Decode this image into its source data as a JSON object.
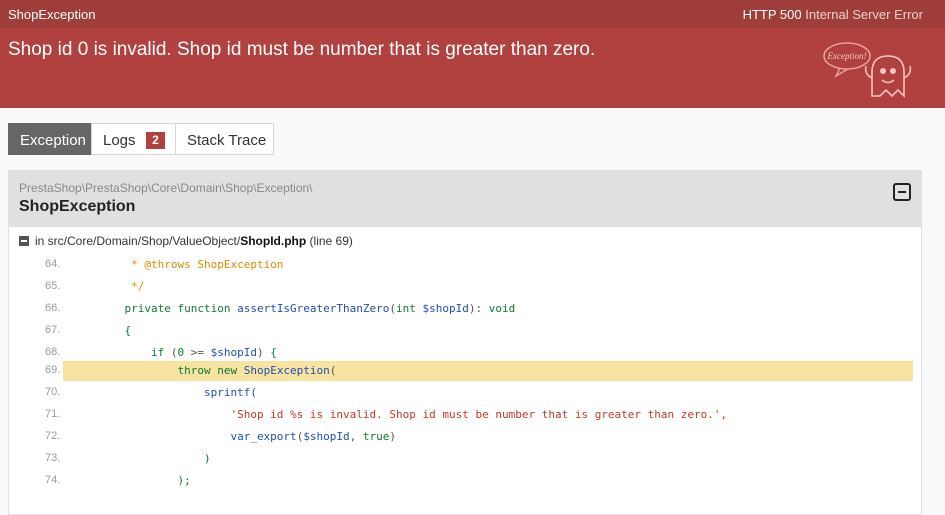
{
  "topbar": {
    "title": "ShopException",
    "status_code": "HTTP 500",
    "status_text": "Internal Server Error"
  },
  "header": {
    "message": "Shop id 0 is invalid. Shop id must be number that is greater than zero.",
    "mascot_text": "Exception!"
  },
  "tabs": [
    {
      "label": "Exception",
      "active": true
    },
    {
      "label": "Logs",
      "badge": "2"
    },
    {
      "label": "Stack Trace"
    }
  ],
  "exception": {
    "namespace": "PrestaShop\\PrestaShop\\Core\\Domain\\Shop\\Exception\\",
    "class_name": "ShopException",
    "location_prefix": "in src/Core/Domain/Shop/ValueObject/",
    "file_name": "ShopId.php",
    "line_info": "(line 69)"
  },
  "code": {
    "highlighted_line": "69.",
    "lines": [
      {
        "num": "64.",
        "text": "     * @throws ShopException"
      },
      {
        "num": "65.",
        "text": "     */"
      },
      {
        "num": "66.",
        "text": "    private function assertIsGreaterThanZero(int $shopId): void"
      },
      {
        "num": "67.",
        "text": "    {"
      },
      {
        "num": "68.",
        "text": "        if (0 >= $shopId) {"
      },
      {
        "num": "69.",
        "text": "            throw new ShopException("
      },
      {
        "num": "70.",
        "text": "                sprintf("
      },
      {
        "num": "71.",
        "text": "                    'Shop id %s is invalid. Shop id must be number that is greater than zero.',"
      },
      {
        "num": "72.",
        "text": "                    var_export($shopId, true)"
      },
      {
        "num": "73.",
        "text": "                )"
      },
      {
        "num": "74.",
        "text": "            );"
      }
    ]
  }
}
